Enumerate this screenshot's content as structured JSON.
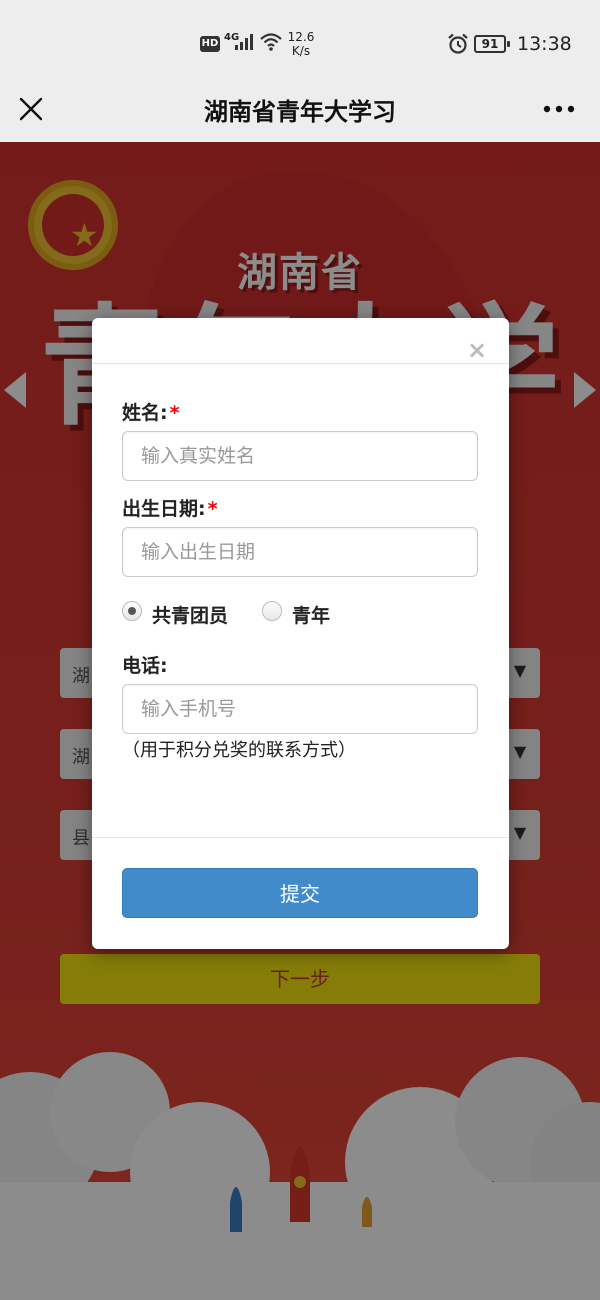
{
  "status_bar": {
    "hd_badge": "HD",
    "network": "4G",
    "speed_value": "12.6",
    "speed_unit": "K/s",
    "battery_level": "91",
    "time": "13:38"
  },
  "title_bar": {
    "title": "湖南省青年大学习",
    "close_icon": "close-icon",
    "more_icon": "more-icon"
  },
  "background": {
    "banner_small": "湖南省",
    "banner_big": "青年大学习",
    "next_button": "下一步",
    "selects": [
      {
        "label": "湖"
      },
      {
        "label": "湖"
      },
      {
        "label": "县"
      }
    ]
  },
  "modal": {
    "name_label": "姓名:",
    "name_placeholder": "输入真实姓名",
    "birth_label": "出生日期:",
    "birth_placeholder": "输入出生日期",
    "required_mark": "*",
    "radio_options": [
      {
        "label": "共青团员",
        "checked": true
      },
      {
        "label": "青年",
        "checked": false
      }
    ],
    "phone_label": "电话:",
    "phone_placeholder": "输入手机号",
    "phone_note": "（用于积分兑奖的联系方式）",
    "submit_label": "提交",
    "close_glyph": "×"
  },
  "colors": {
    "background_red": "#d3322f",
    "submit_blue": "#428bca",
    "next_yellow": "#f3e410",
    "required_red": "#ee0000"
  }
}
